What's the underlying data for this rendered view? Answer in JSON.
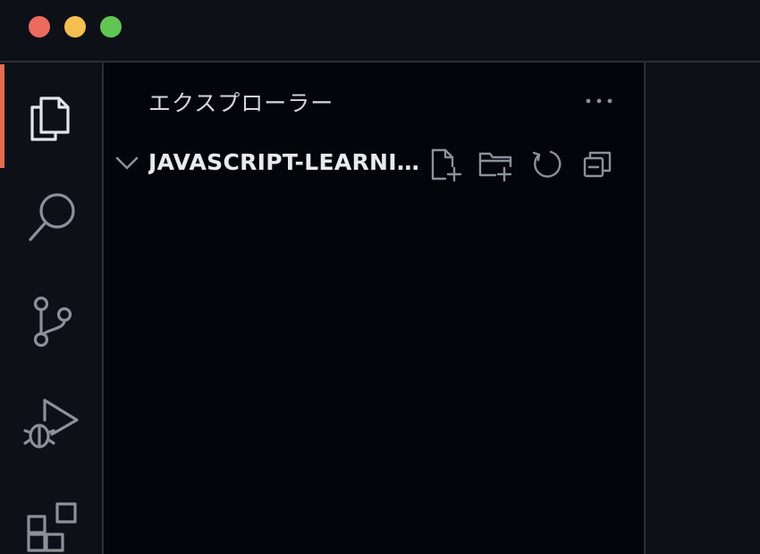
{
  "colors": {
    "titlebar_bg": "#0d1016",
    "activitybar_bg": "#0d1016",
    "sidebar_bg": "#04050a",
    "editor_bg": "#0d1016",
    "border": "#2b2e35",
    "accent": "#e46c4f",
    "icon": "#8c909a",
    "icon_active": "#e3e5ea",
    "traffic_close": "#ec6a5e",
    "traffic_minimize": "#f4bf4f",
    "traffic_maximize": "#61c554"
  },
  "window_controls": [
    "close",
    "minimize",
    "maximize"
  ],
  "activity_bar": {
    "active": "explorer",
    "items": [
      {
        "id": "explorer",
        "icon": "files-icon"
      },
      {
        "id": "search",
        "icon": "search-icon"
      },
      {
        "id": "source-control",
        "icon": "source-control-icon"
      },
      {
        "id": "run-debug",
        "icon": "run-debug-icon"
      },
      {
        "id": "extensions",
        "icon": "extensions-icon"
      }
    ]
  },
  "sidebar": {
    "title": "エクスプローラー",
    "more_actions_icon": "ellipsis-icon",
    "folder": {
      "name": "JAVASCRIPT-LEARNING",
      "expanded": true,
      "actions": [
        {
          "id": "new-file",
          "icon": "new-file-icon"
        },
        {
          "id": "new-folder",
          "icon": "new-folder-icon"
        },
        {
          "id": "refresh",
          "icon": "refresh-icon"
        },
        {
          "id": "collapse-all",
          "icon": "collapse-all-icon"
        }
      ]
    }
  }
}
